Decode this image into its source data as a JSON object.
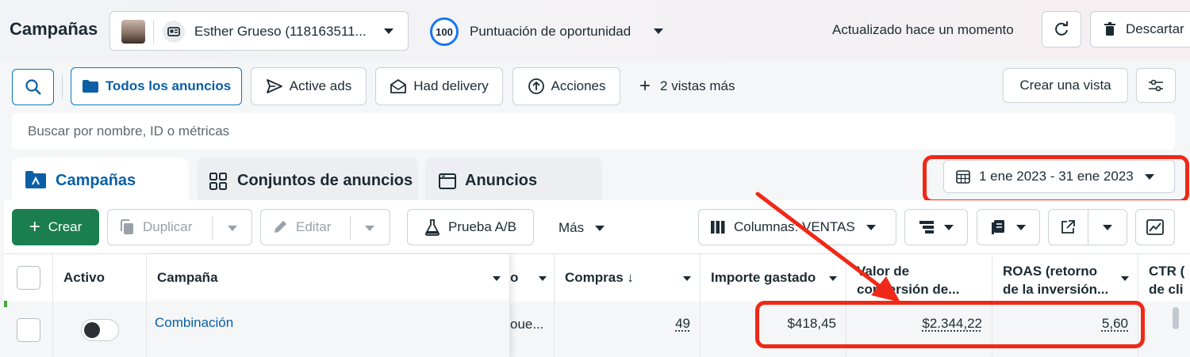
{
  "header": {
    "title": "Campañas",
    "account_name": "Esther Grueso (118163511...",
    "score_value": "100",
    "score_label": "Puntuación de oportunidad",
    "updated_text": "Actualizado hace un momento",
    "discard_label": "Descartar"
  },
  "filters": {
    "all_ads": "Todos los anuncios",
    "active_ads": "Active ads",
    "had_delivery": "Had delivery",
    "actions": "Acciones",
    "more_views": "2 vistas más",
    "create_view": "Crear una vista"
  },
  "search": {
    "placeholder": "Buscar por nombre, ID o métricas"
  },
  "tabs": [
    {
      "label": "Campañas"
    },
    {
      "label": "Conjuntos de anuncios"
    },
    {
      "label": "Anuncios"
    }
  ],
  "date_range": "1 ene 2023 - 31 ene 2023",
  "toolbar": {
    "create": "Crear",
    "duplicate": "Duplicar",
    "edit": "Editar",
    "ab_test": "Prueba A/B",
    "more": "Más",
    "columns": "Columnas: VENTAS"
  },
  "table": {
    "headers": {
      "active": "Activo",
      "campaign": "Campaña",
      "purchases": "Compras ↓",
      "spent": "Importe gastado",
      "conv_value_1": "Valor de",
      "conv_value_2": "conversión de...",
      "roas_1": "ROAS (retorno",
      "roas_2": "de la inversión...",
      "ctr_1": "CTR (",
      "ctr_2": "de cli"
    },
    "rows": [
      {
        "campaign": "Combinación",
        "hidden_col": "oue...",
        "purchases": "49",
        "spent": "$418,45",
        "conv_value": "$2.344,22",
        "roas": "5,60"
      }
    ]
  },
  "colors": {
    "annotation": "#f02817",
    "brand_blue": "#0a5fa6",
    "create_green": "#1a7e4e"
  }
}
